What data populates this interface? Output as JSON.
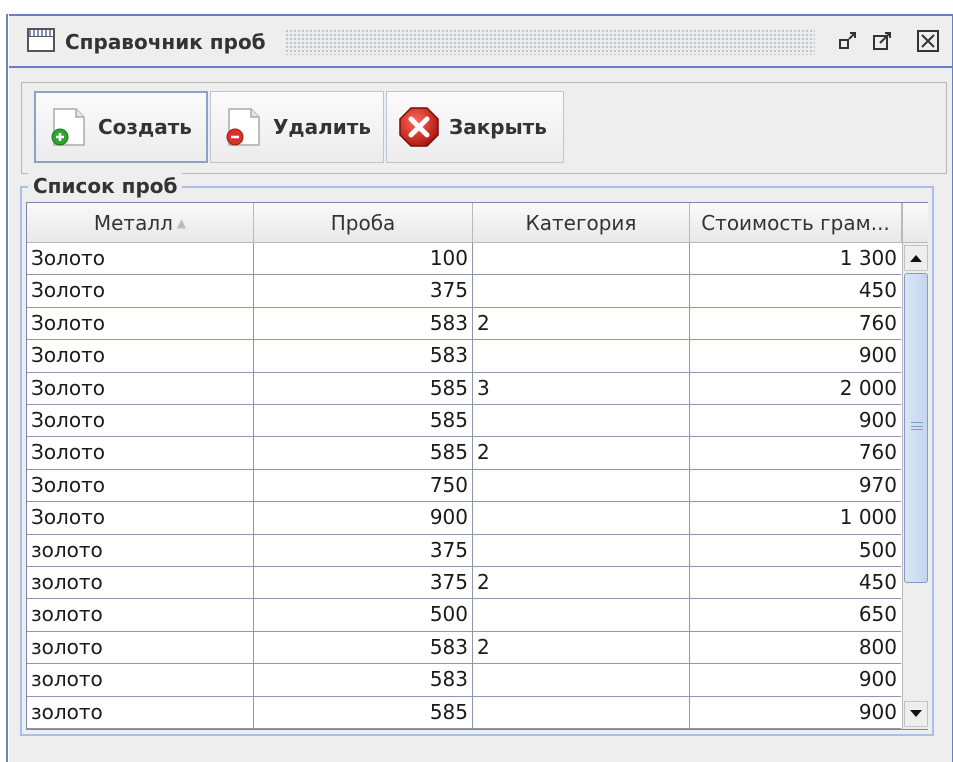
{
  "window": {
    "title": "Справочник проб",
    "icons": [
      "window-icon",
      "restore-icon",
      "maximize-icon",
      "close-icon"
    ]
  },
  "toolbar": {
    "create_label": "Создать",
    "delete_label": "Удалить",
    "close_label": "Закрыть",
    "icons": [
      "document-add-icon",
      "document-remove-icon",
      "close-circle-icon"
    ],
    "colors": {
      "add": "#2fa52f",
      "remove": "#d9322a",
      "close": "#c0201a"
    }
  },
  "group": {
    "label": "Список проб"
  },
  "table": {
    "columns": [
      "Металл",
      "Проба",
      "Категория",
      "Стоимость грам..."
    ],
    "sorted_column": "Металл",
    "rows": [
      [
        "Золото",
        "100",
        "",
        "1 300"
      ],
      [
        "Золото",
        "375",
        "",
        "450"
      ],
      [
        "Золото",
        "583",
        "2",
        "760"
      ],
      [
        "Золото",
        "583",
        "",
        "900"
      ],
      [
        "Золото",
        "585",
        "3",
        "2 000"
      ],
      [
        "Золото",
        "585",
        "",
        "900"
      ],
      [
        "Золото",
        "585",
        "2",
        "760"
      ],
      [
        "Золото",
        "750",
        "",
        "970"
      ],
      [
        "Золото",
        "900",
        "",
        "1 000"
      ],
      [
        "золото",
        "375",
        "",
        "500"
      ],
      [
        "золото",
        "375",
        "2",
        "450"
      ],
      [
        "золото",
        "500",
        "",
        "650"
      ],
      [
        "золото",
        "583",
        "2",
        "800"
      ],
      [
        "золото",
        "583",
        "",
        "900"
      ],
      [
        "золото",
        "585",
        "",
        "900"
      ]
    ]
  }
}
